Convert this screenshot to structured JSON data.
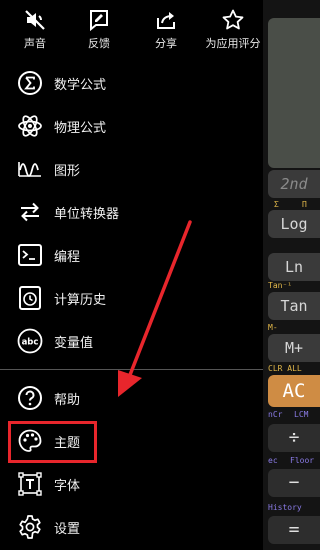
{
  "top_actions": [
    {
      "label": "声音",
      "icon": "sound-off-icon"
    },
    {
      "label": "反馈",
      "icon": "feedback-icon"
    },
    {
      "label": "分享",
      "icon": "share-icon"
    },
    {
      "label": "为应用评分",
      "icon": "star-icon"
    }
  ],
  "menu": [
    {
      "label": "数学公式",
      "icon": "sigma-icon"
    },
    {
      "label": "物理公式",
      "icon": "atom-icon"
    },
    {
      "label": "图形",
      "icon": "graph-wave-icon"
    },
    {
      "label": "单位转换器",
      "icon": "swap-arrows-icon"
    },
    {
      "label": "编程",
      "icon": "terminal-icon"
    },
    {
      "label": "计算历史",
      "icon": "history-icon"
    },
    {
      "label": "变量值",
      "icon": "abc-icon"
    }
  ],
  "menu_secondary": [
    {
      "label": "帮助",
      "icon": "help-icon"
    },
    {
      "label": "主题",
      "icon": "palette-icon"
    },
    {
      "label": "字体",
      "icon": "font-icon"
    },
    {
      "label": "设置",
      "icon": "gear-icon"
    }
  ],
  "calculator": {
    "keys": [
      "2nd",
      "Log",
      "Ln",
      "Tan",
      "M+",
      "AC",
      "÷",
      "−",
      "="
    ],
    "mini_labels": [
      "Σ",
      "Π",
      "Tan⁻¹",
      "M-",
      "CLR ALL",
      "nCr",
      "LCM",
      "ec",
      "Floor",
      "History"
    ]
  },
  "colors": {
    "highlight": "#e8262c",
    "arrow": "#e8262c",
    "ac_key": "#cf8c44"
  }
}
